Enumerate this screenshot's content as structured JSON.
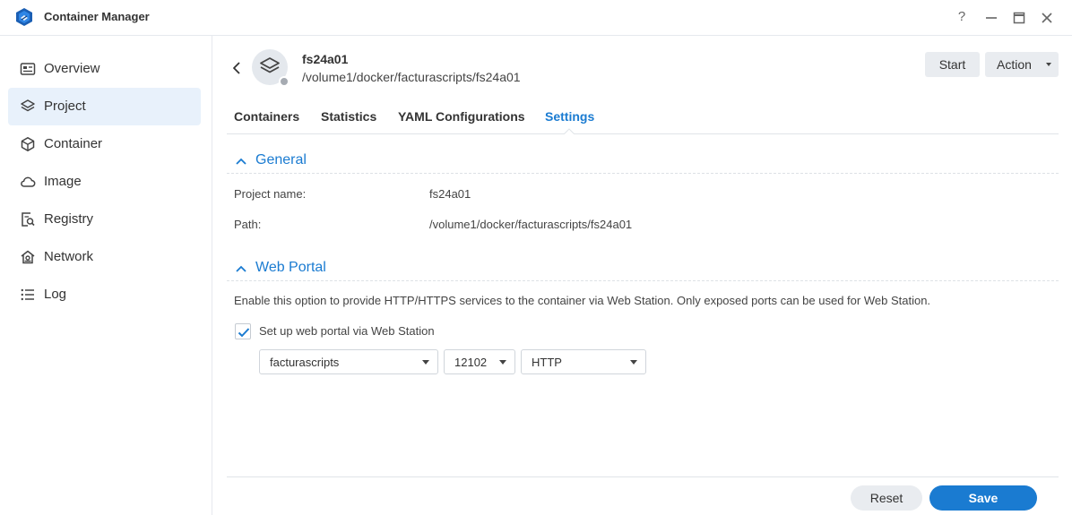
{
  "window": {
    "title": "Container Manager",
    "controls": {
      "help": "?",
      "minimize": "—",
      "maximize": "▢",
      "close": "✕"
    }
  },
  "sidebar": {
    "items": [
      {
        "label": "Overview",
        "icon": "overview-icon",
        "active": false
      },
      {
        "label": "Project",
        "icon": "project-icon",
        "active": true
      },
      {
        "label": "Container",
        "icon": "container-icon",
        "active": false
      },
      {
        "label": "Image",
        "icon": "image-icon",
        "active": false
      },
      {
        "label": "Registry",
        "icon": "registry-icon",
        "active": false
      },
      {
        "label": "Network",
        "icon": "network-icon",
        "active": false
      },
      {
        "label": "Log",
        "icon": "log-icon",
        "active": false
      }
    ]
  },
  "project": {
    "name": "fs24a01",
    "path": "/volume1/docker/facturascripts/fs24a01"
  },
  "header_actions": {
    "start_label": "Start",
    "action_label": "Action"
  },
  "tabs": [
    {
      "label": "Containers",
      "active": false
    },
    {
      "label": "Statistics",
      "active": false
    },
    {
      "label": "YAML Configurations",
      "active": false
    },
    {
      "label": "Settings",
      "active": true
    }
  ],
  "general": {
    "title": "General",
    "project_name_label": "Project name:",
    "project_name_value": "fs24a01",
    "path_label": "Path:",
    "path_value": "/volume1/docker/facturascripts/fs24a01"
  },
  "web_portal": {
    "title": "Web Portal",
    "description": "Enable this option to provide HTTP/HTTPS services to the container via Web Station. Only exposed ports can be used for Web Station.",
    "checkbox_label": "Set up web portal via Web Station",
    "checked": true,
    "service_select": "facturascripts",
    "port_select": "12102",
    "protocol_select": "HTTP"
  },
  "footer": {
    "reset_label": "Reset",
    "save_label": "Save"
  },
  "colors": {
    "accent": "#1a7bd1",
    "active_nav_bg": "#e8f1fb"
  }
}
